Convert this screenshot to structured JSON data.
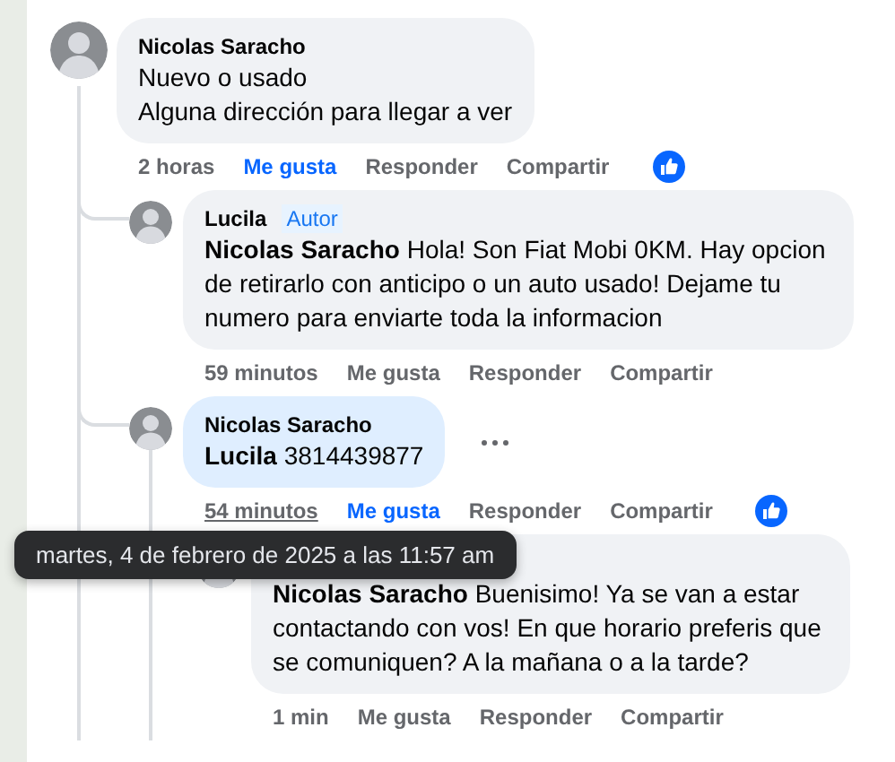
{
  "comments": [
    {
      "author": "Nicolas Saracho",
      "lines": [
        "Nuevo o usado",
        "Alguna dirección para llegar a ver"
      ],
      "highlighted": false,
      "more_menu": false,
      "time": "2 horas",
      "time_hovered": false,
      "like": "Me gusta",
      "liked": true,
      "reply": "Responder",
      "share": "Compartir",
      "reacted": true,
      "children": [
        {
          "author": "Lucila",
          "badge": "Autor",
          "lines": [
            "**Nicolas Saracho** Hola! Son Fiat Mobi 0KM. Hay opcion de retirarlo con anticipo o un auto usado! Dejame tu numero para enviarte toda la informacion"
          ],
          "highlighted": false,
          "more_menu": false,
          "time": "59 minutos",
          "time_hovered": false,
          "like": "Me gusta",
          "liked": false,
          "reply": "Responder",
          "share": "Compartir",
          "reacted": false
        },
        {
          "author": "Nicolas Saracho",
          "lines": [
            "**Lucila** 3814439877"
          ],
          "highlighted": true,
          "more_menu": true,
          "time": "54 minutos",
          "time_hovered": true,
          "like": "Me gusta",
          "liked": true,
          "reply": "Responder",
          "share": "Compartir",
          "reacted": true,
          "children": [
            {
              "lines": [
                "**Nicolas Saracho** Buenisimo! Ya se van a estar contactando con vos! En que horario preferis que se comuniquen? A la mañana o a la tarde?"
              ],
              "highlighted": false,
              "more_menu": false,
              "time": "1 min",
              "time_hovered": false,
              "like": "Me gusta",
              "liked": false,
              "reply": "Responder",
              "share": "Compartir",
              "reacted": false
            }
          ]
        }
      ]
    }
  ],
  "tooltip": {
    "text": "martes, 4 de febrero de 2025 a las 11:57 am"
  }
}
